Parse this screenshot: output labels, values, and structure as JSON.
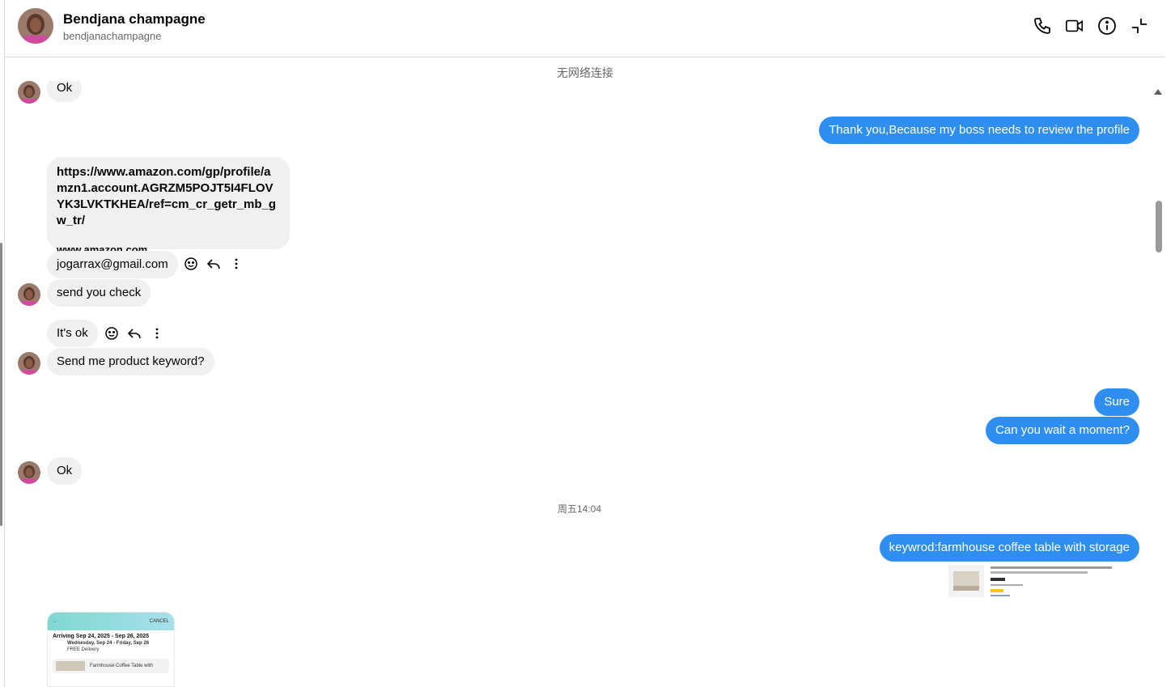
{
  "contact": {
    "name": "Bendjana champagne",
    "username": "bendjanachampagne"
  },
  "header_icons": [
    "phone-icon",
    "video-call-icon",
    "info-icon",
    "minimize-icon"
  ],
  "status_text": "无网络连接",
  "messages": {
    "ok_top": "Ok",
    "thank_you": "Thank you,Because my boss needs to review the profile",
    "link_url": "https://www.amazon.com/gp/profile/amzn1.account.AGRZM5POJT5I4FLOVYK3LVKTKHEA/ref=cm_cr_getr_mb_gw_tr/",
    "link_domain": "www.amazon.com",
    "email": "jogarrax@gmail.com",
    "send_check": "send you check",
    "its_ok": "It's ok",
    "keyword_q": "Send me product keyword?",
    "sure": "Sure",
    "wait": "Can you wait a moment?",
    "ok_bottom": "Ok",
    "timestamp": "周五14:04",
    "keyword_msg": "keywrod:farmhouse coffee table with storage"
  },
  "thumb_in": {
    "cancel": "CANCEL",
    "arriving": "Arriving Sep 24, 2025 - Sep 26, 2025",
    "option": "Wednesday, Sep 24 - Friday, Sep 26",
    "delivery": "FREE Delivery",
    "product": "Farmhouse Coffee Table with"
  },
  "colors": {
    "outgoing_bubble": "#2f8ff0",
    "incoming_bubble": "#f0f0f0"
  }
}
